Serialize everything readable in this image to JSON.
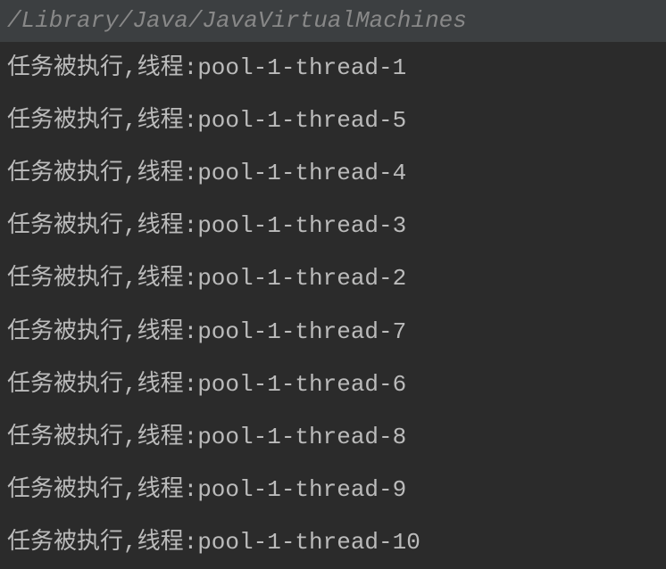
{
  "path": "/Library/Java/JavaVirtualMachines",
  "output_lines": [
    "任务被执行,线程:pool-1-thread-1",
    "任务被执行,线程:pool-1-thread-5",
    "任务被执行,线程:pool-1-thread-4",
    "任务被执行,线程:pool-1-thread-3",
    "任务被执行,线程:pool-1-thread-2",
    "任务被执行,线程:pool-1-thread-7",
    "任务被执行,线程:pool-1-thread-6",
    "任务被执行,线程:pool-1-thread-8",
    "任务被执行,线程:pool-1-thread-9",
    "任务被执行,线程:pool-1-thread-10"
  ]
}
